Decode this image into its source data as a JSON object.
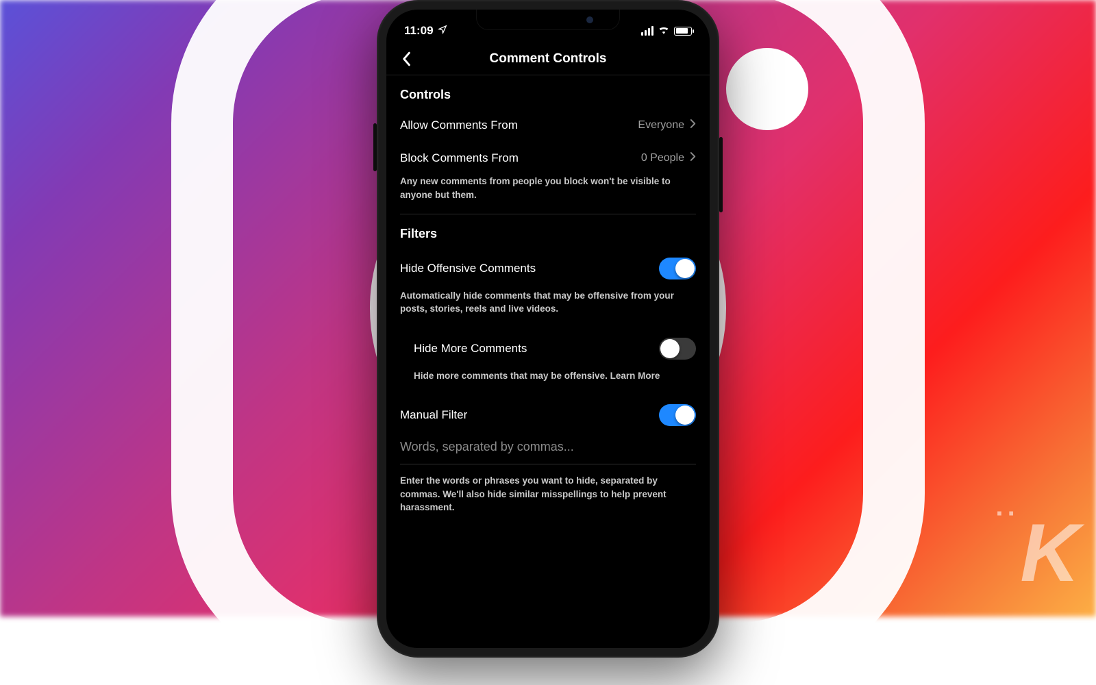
{
  "statusbar": {
    "time": "11:09"
  },
  "navbar": {
    "title": "Comment Controls"
  },
  "sections": {
    "controls": {
      "title": "Controls",
      "allow": {
        "label": "Allow Comments From",
        "value": "Everyone"
      },
      "block": {
        "label": "Block Comments From",
        "value": "0 People"
      },
      "block_help": "Any new comments from people you block won't be visible to anyone but them."
    },
    "filters": {
      "title": "Filters",
      "hide_offensive": {
        "label": "Hide Offensive Comments",
        "on": true
      },
      "hide_offensive_help": "Automatically hide comments that may be offensive from your posts, stories, reels and live videos.",
      "hide_more": {
        "label": "Hide More Comments",
        "on": false
      },
      "hide_more_help": "Hide more comments that may be offensive. ",
      "learn_more": "Learn More",
      "manual": {
        "label": "Manual Filter",
        "on": true
      },
      "manual_placeholder": "Words, separated by commas...",
      "manual_help": "Enter the words or phrases you want to hide, separated by commas. We'll also hide similar misspellings to help prevent harassment."
    }
  }
}
